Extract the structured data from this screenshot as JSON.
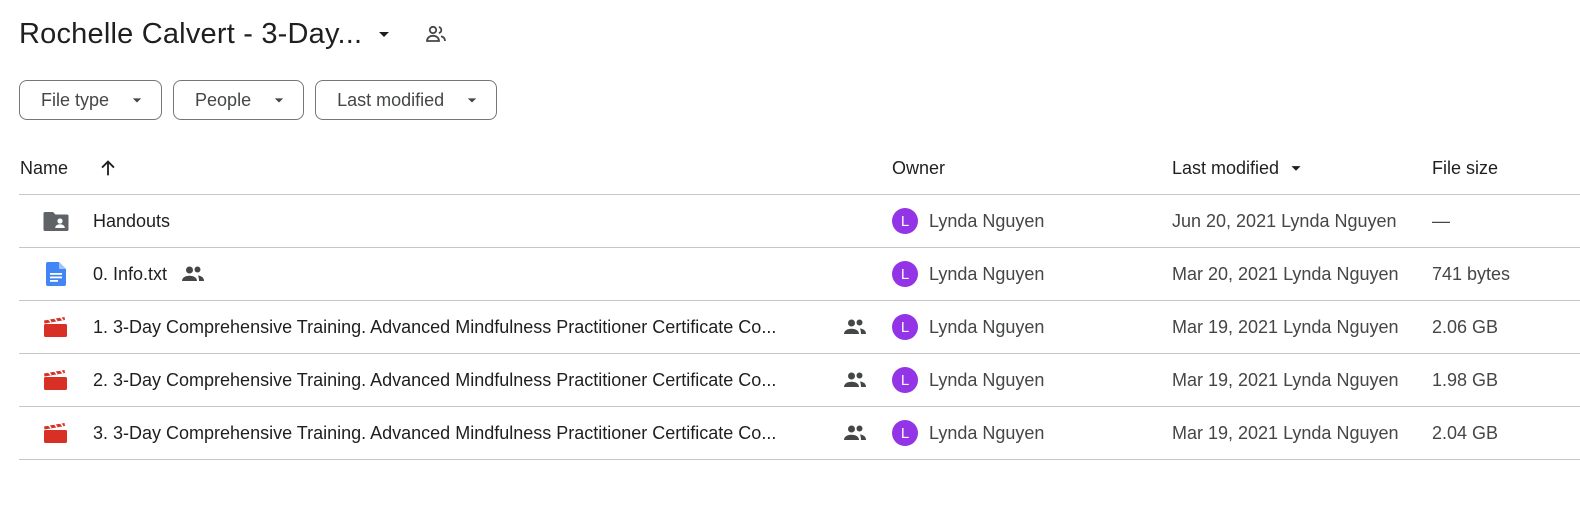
{
  "header": {
    "folder_title": "Rochelle Calvert - 3-Day...",
    "caret_icon": "arrow-drop-down-icon",
    "shared_icon": "people-outline-icon"
  },
  "filters": [
    {
      "label": "File type"
    },
    {
      "label": "People"
    },
    {
      "label": "Last modified"
    }
  ],
  "table": {
    "columns": {
      "name": "Name",
      "owner": "Owner",
      "last_modified": "Last modified",
      "file_size": "File size"
    },
    "rows": [
      {
        "name": "Handouts",
        "type": "shared-folder",
        "shared": false,
        "owner_initial": "L",
        "owner": "Lynda Nguyen",
        "modified": "Jun 20, 2021 Lynda Nguyen",
        "size": "—"
      },
      {
        "name": "0. Info.txt",
        "type": "document",
        "shared": true,
        "owner_initial": "L",
        "owner": "Lynda Nguyen",
        "modified": "Mar 20, 2021 Lynda Nguyen",
        "size": "741 bytes"
      },
      {
        "name": "1. 3-Day Comprehensive Training.  Advanced Mindfulness Practitioner Certificate Co...",
        "type": "video",
        "shared": true,
        "owner_initial": "L",
        "owner": "Lynda Nguyen",
        "modified": "Mar 19, 2021 Lynda Nguyen",
        "size": "2.06 GB"
      },
      {
        "name": "2. 3-Day Comprehensive Training.  Advanced Mindfulness Practitioner Certificate Co...",
        "type": "video",
        "shared": true,
        "owner_initial": "L",
        "owner": "Lynda Nguyen",
        "modified": "Mar 19, 2021 Lynda Nguyen",
        "size": "1.98 GB"
      },
      {
        "name": "3. 3-Day Comprehensive Training.  Advanced Mindfulness Practitioner Certificate Co...",
        "type": "video",
        "shared": true,
        "owner_initial": "L",
        "owner": "Lynda Nguyen",
        "modified": "Mar 19, 2021 Lynda Nguyen",
        "size": "2.04 GB"
      }
    ]
  },
  "colors": {
    "avatar": "#9334e6",
    "doc_icon": "#4285f4",
    "video_icon": "#d93025",
    "folder_icon": "#5f6368",
    "divider": "#c7c7c7"
  }
}
